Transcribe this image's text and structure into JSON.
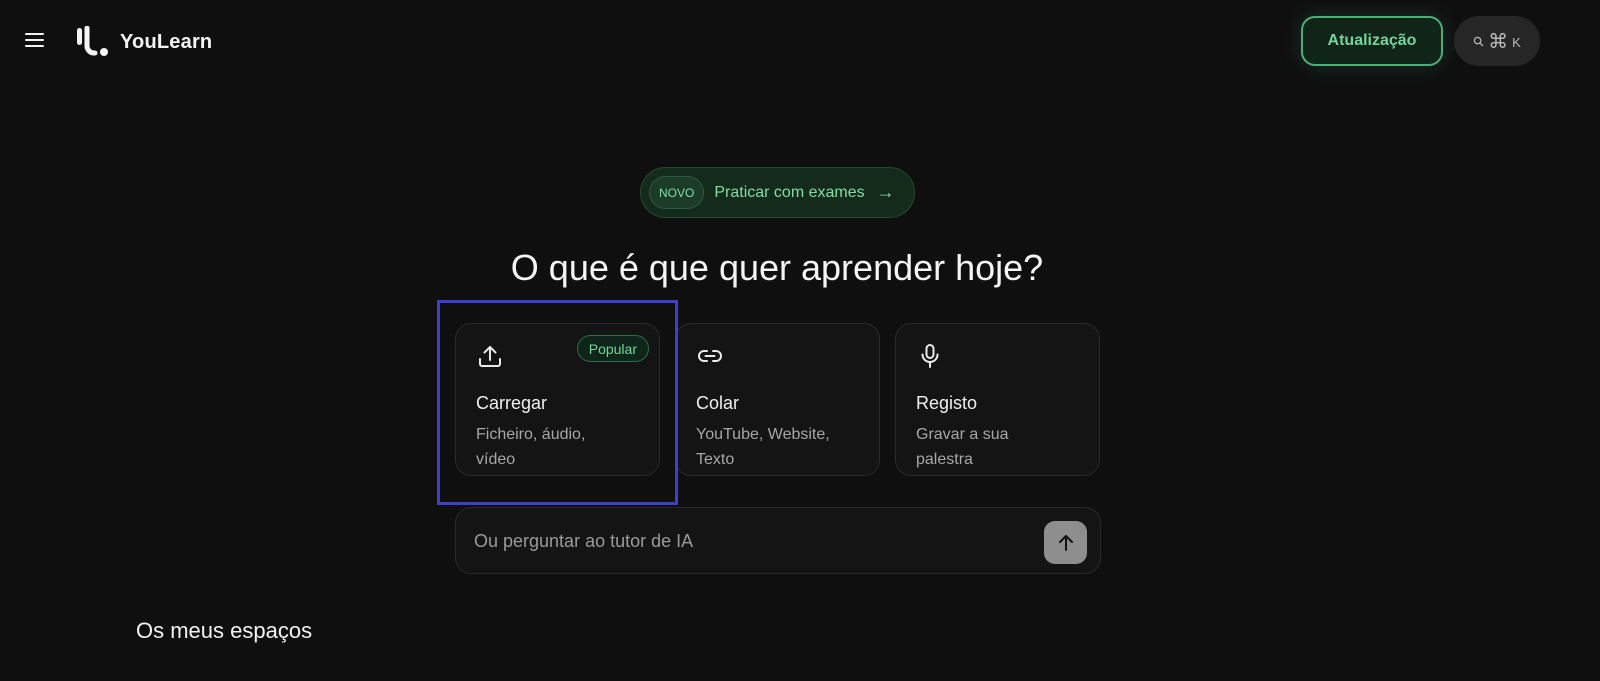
{
  "header": {
    "brand": "YouLearn",
    "upgrade_label": "Atualização",
    "search_shortcut": {
      "cmd": "⌘",
      "key": "K"
    }
  },
  "promo": {
    "badge": "NOVO",
    "label": "Praticar com exames",
    "arrow": "→"
  },
  "main": {
    "heading": "O que é que quer aprender hoje?",
    "cards": [
      {
        "icon": "upload-icon",
        "title": "Carregar",
        "description": "Ficheiro, áudio, vídeo",
        "badge": "Popular"
      },
      {
        "icon": "link-icon",
        "title": "Colar",
        "description": "YouTube, Website, Texto"
      },
      {
        "icon": "microphone-icon",
        "title": "Registo",
        "description": "Gravar a sua palestra"
      }
    ],
    "ask": {
      "placeholder": "Ou perguntar ao tutor de IA",
      "value": ""
    }
  },
  "spaces": {
    "title": "Os meus espaços"
  },
  "colors": {
    "background": "#0f0f10",
    "accent_green": "#74d59c",
    "highlight": "#3d3fcf"
  }
}
